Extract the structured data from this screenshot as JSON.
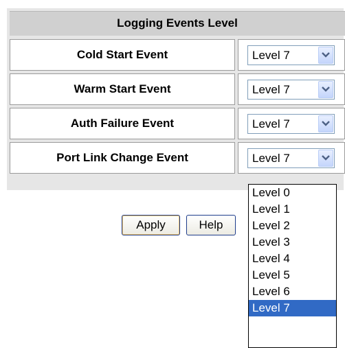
{
  "table": {
    "header": "Logging Events Level",
    "rows": [
      {
        "label": "Cold Start Event",
        "value": "Level 7"
      },
      {
        "label": "Warm Start Event",
        "value": "Level 7"
      },
      {
        "label": "Auth Failure Event",
        "value": "Level 7"
      },
      {
        "label": "Port Link Change Event",
        "value": "Level 7"
      }
    ]
  },
  "buttons": {
    "apply": "Apply",
    "help": "Help"
  },
  "dropdown": {
    "options": [
      "Level 0",
      "Level 1",
      "Level 2",
      "Level 3",
      "Level 4",
      "Level 5",
      "Level 6",
      "Level 7"
    ],
    "selected": "Level 7"
  },
  "colors": {
    "header_bg": "#d0d0d0",
    "selection": "#316ac5",
    "button_border": "#1c3b8a"
  }
}
